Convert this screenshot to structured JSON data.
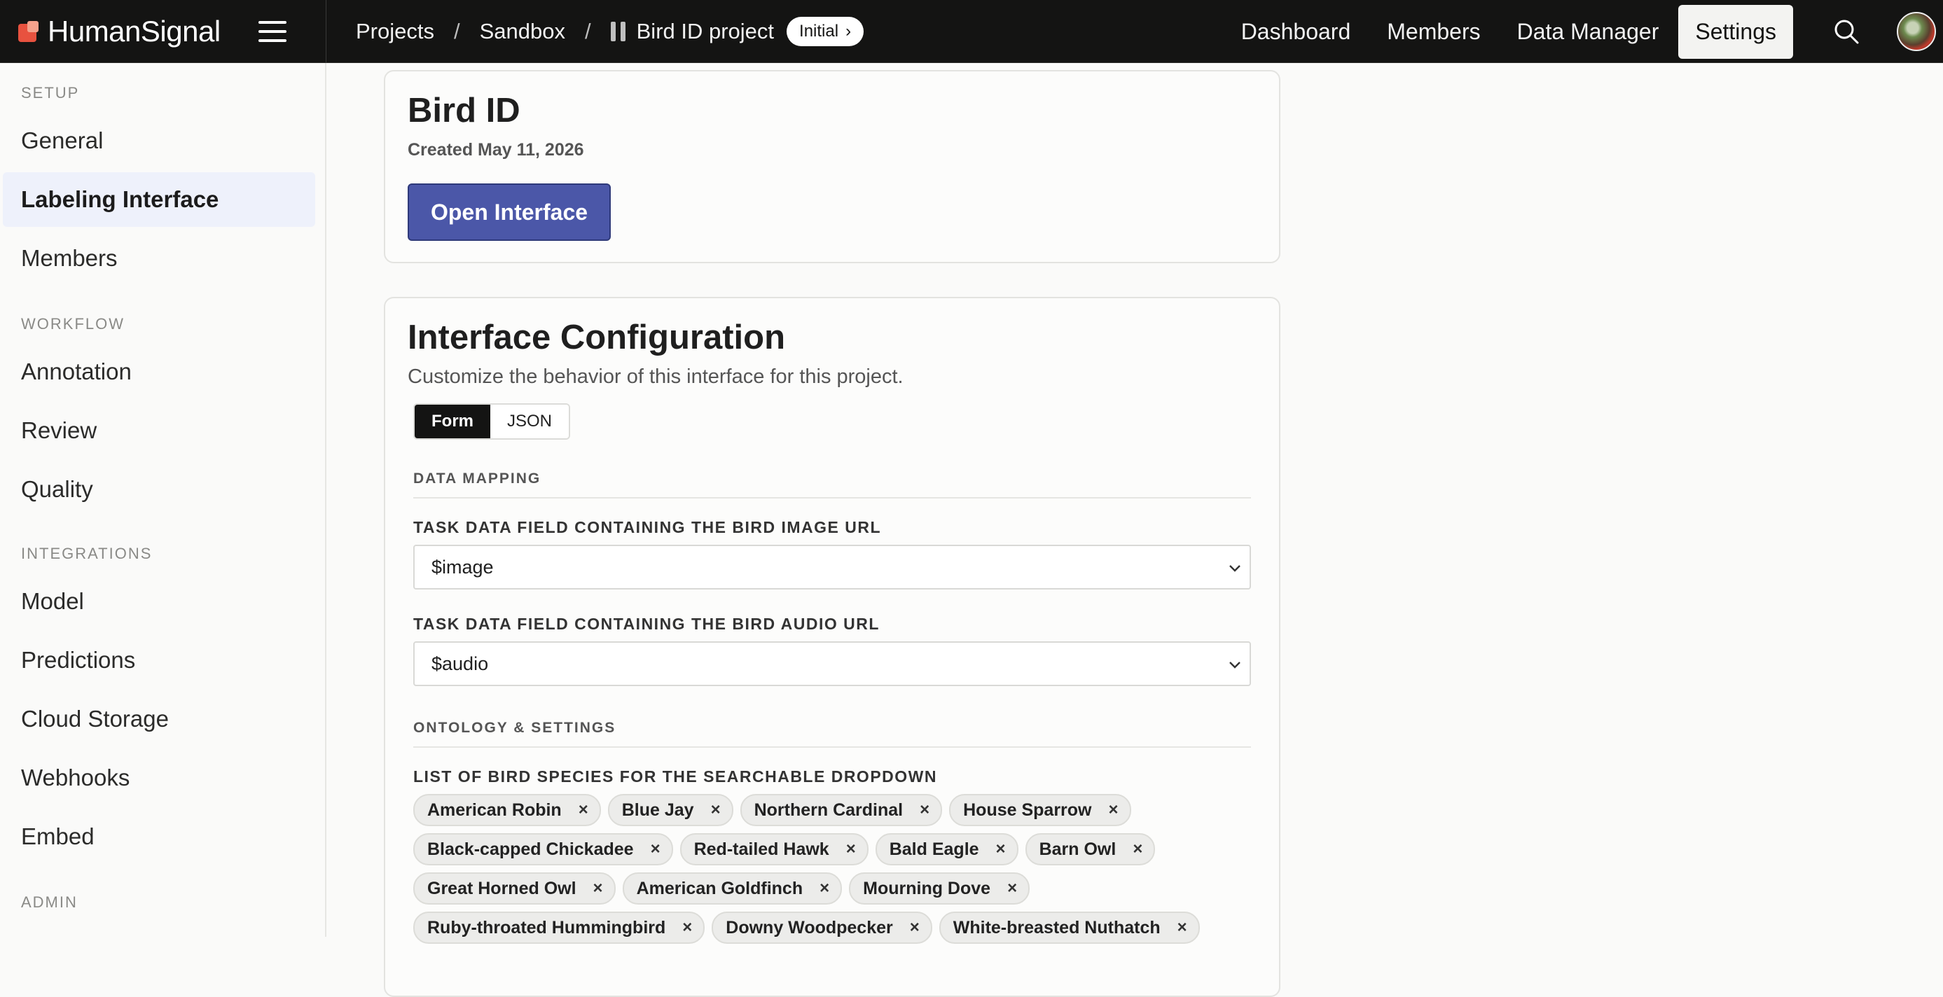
{
  "brand": {
    "name": "HumanSignal"
  },
  "breadcrumbs": {
    "projects": "Projects",
    "sep1": "/",
    "workspace": "Sandbox",
    "sep2": "/",
    "project": "Bird ID project",
    "state_pill": "Initial",
    "state_pill_chevron": "›"
  },
  "topnav": {
    "dashboard": "Dashboard",
    "members": "Members",
    "data_manager": "Data Manager",
    "settings": "Settings"
  },
  "sidebar": {
    "setup_label": "SETUP",
    "workflow_label": "WORKFLOW",
    "integrations_label": "INTEGRATIONS",
    "admin_label": "ADMIN",
    "items": [
      {
        "label": "General"
      },
      {
        "label": "Labeling Interface",
        "active": true
      },
      {
        "label": "Members"
      },
      {
        "label": "Annotation"
      },
      {
        "label": "Review"
      },
      {
        "label": "Quality"
      },
      {
        "label": "Model"
      },
      {
        "label": "Predictions"
      },
      {
        "label": "Cloud Storage"
      },
      {
        "label": "Webhooks"
      },
      {
        "label": "Embed"
      }
    ]
  },
  "project_card": {
    "title": "Bird ID",
    "created": "Created May 11, 2026",
    "open_button": "Open Interface"
  },
  "config": {
    "title": "Interface Configuration",
    "subtitle": "Customize the behavior of this interface for this project.",
    "tabs": [
      "Form",
      "JSON"
    ],
    "active_tab": "Form",
    "data_mapping_label": "DATA MAPPING",
    "image_field_label": "TASK DATA FIELD CONTAINING THE BIRD IMAGE URL",
    "image_field_value": "$image",
    "audio_field_label": "TASK DATA FIELD CONTAINING THE BIRD AUDIO URL",
    "audio_field_value": "$audio",
    "ontology_label": "ONTOLOGY & SETTINGS",
    "species_label": "LIST OF BIRD SPECIES FOR THE SEARCHABLE DROPDOWN",
    "species_rows": [
      [
        "American Robin",
        "Blue Jay",
        "Northern Cardinal",
        "House Sparrow"
      ],
      [
        "Black-capped Chickadee",
        "Red-tailed Hawk",
        "Bald Eagle",
        "Barn Owl"
      ],
      [
        "Great Horned Owl",
        "American Goldfinch",
        "Mourning Dove"
      ],
      [
        "Ruby-throated Hummingbird",
        "Downy Woodpecker",
        "White-breasted Nuthatch"
      ]
    ],
    "chip_remove_glyph": "×"
  },
  "colors": {
    "topbar_bg": "#141413",
    "accent_button": "#4b57a8",
    "active_nav_bg": "#eef1fb",
    "logo_orange": "#e8523f"
  },
  "icons": {
    "menu": "hamburger-icon",
    "pause": "pause-icon",
    "search": "search-icon",
    "chevron": "chevron-down-icon",
    "remove": "close-icon"
  }
}
